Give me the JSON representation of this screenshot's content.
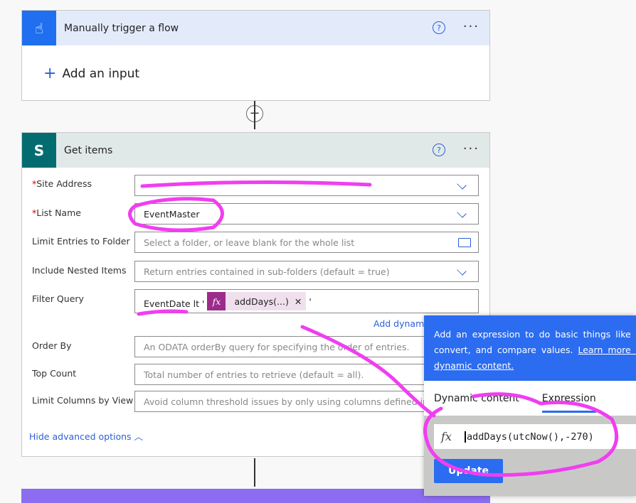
{
  "trigger": {
    "title": "Manually trigger a flow",
    "add_input": "Add an input",
    "icon": "hand-touch-icon",
    "color": "#1f6ff0"
  },
  "get_items": {
    "title": "Get items",
    "icon": "sharepoint-icon",
    "icon_letter": "S",
    "color": "#036c70",
    "fields": [
      {
        "label": "Site Address",
        "required": true,
        "value": "",
        "placeholder": ""
      },
      {
        "label": "List Name",
        "required": true,
        "value": "EventMaster"
      },
      {
        "label": "Limit Entries to Folder",
        "placeholder": "Select a folder, or leave blank for the whole list"
      },
      {
        "label": "Include Nested Items",
        "placeholder": "Return entries contained in sub-folders (default = true)"
      },
      {
        "label": "Filter Query",
        "text": "EventDate lt '",
        "token": "addDays(...)",
        "suffix": "'"
      },
      {
        "label": "Order By",
        "placeholder": "An ODATA orderBy query for specifying the order of entries."
      },
      {
        "label": "Top Count",
        "placeholder": "Total number of entries to retrieve (default = all)."
      },
      {
        "label": "Limit Columns by View",
        "placeholder": "Avoid column threshold issues by only using columns defined in a view"
      }
    ],
    "add_dynamic": "Add dynamic content",
    "hide_advanced": "Hide advanced options"
  },
  "popup": {
    "info": "Add an expression to do basic things like access,",
    "info2": "convert, and compare values.",
    "learn": "Learn more about",
    "learn2": "dynamic content.",
    "tab_dynamic": "Dynamic content",
    "tab_expression": "Expression",
    "fx": "fx",
    "expression": "addDays(utcNow(),-270)",
    "update": "Update"
  },
  "colors": {
    "accent": "#2b6cf0",
    "annotation": "#f03ef0",
    "token": "#9c2b8c"
  }
}
